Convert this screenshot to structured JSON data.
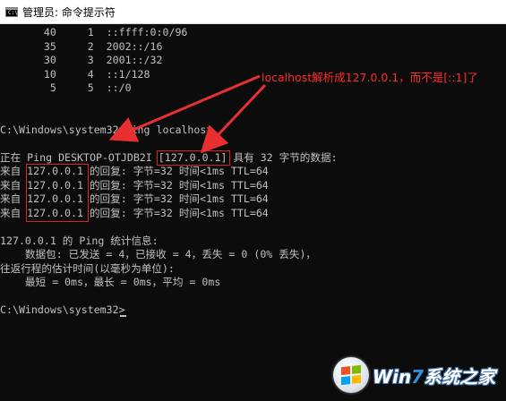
{
  "window": {
    "title": "管理员: 命令提示符",
    "icon": "cmd-icon",
    "icon_glyph": "C:\\"
  },
  "console": {
    "lines": [
      "       40     1  ::ffff:0:0/96",
      "       35     2  2002::/16",
      "       30     3  2001::/32",
      "       10     4  ::1/128",
      "        5     5  ::/0",
      "",
      "",
      "C:\\Windows\\system32>ping localhost",
      "",
      "正在 Ping DESKTOP-OTJDB2I [127.0.0.1] 具有 32 字节的数据:",
      "来自 127.0.0.1 的回复: 字节=32 时间<1ms TTL=64",
      "来自 127.0.0.1 的回复: 字节=32 时间<1ms TTL=64",
      "来自 127.0.0.1 的回复: 字节=32 时间<1ms TTL=64",
      "来自 127.0.0.1 的回复: 字节=32 时间<1ms TTL=64",
      "",
      "127.0.0.1 的 Ping 统计信息:",
      "    数据包: 已发送 = 4，已接收 = 4，丢失 = 0 (0% 丢失)，",
      "往返行程的估计时间(以毫秒为单位):",
      "    最短 = 0ms，最长 = 0ms，平均 = 0ms",
      "",
      "C:\\Windows\\system32>"
    ]
  },
  "annotation": {
    "text": "localhost解析成127.0.0.1，而不是[::1]了",
    "color": "#ff2a2a"
  },
  "watermark": {
    "text_a": "Win",
    "text_seven": "7",
    "text_b": "系统之家"
  },
  "colors": {
    "background": "#0c0c0c",
    "foreground": "#c0c0c0",
    "highlight": "#e02020",
    "flag": [
      "#f25022",
      "#7fba00",
      "#00a4ef",
      "#ffb900"
    ]
  }
}
